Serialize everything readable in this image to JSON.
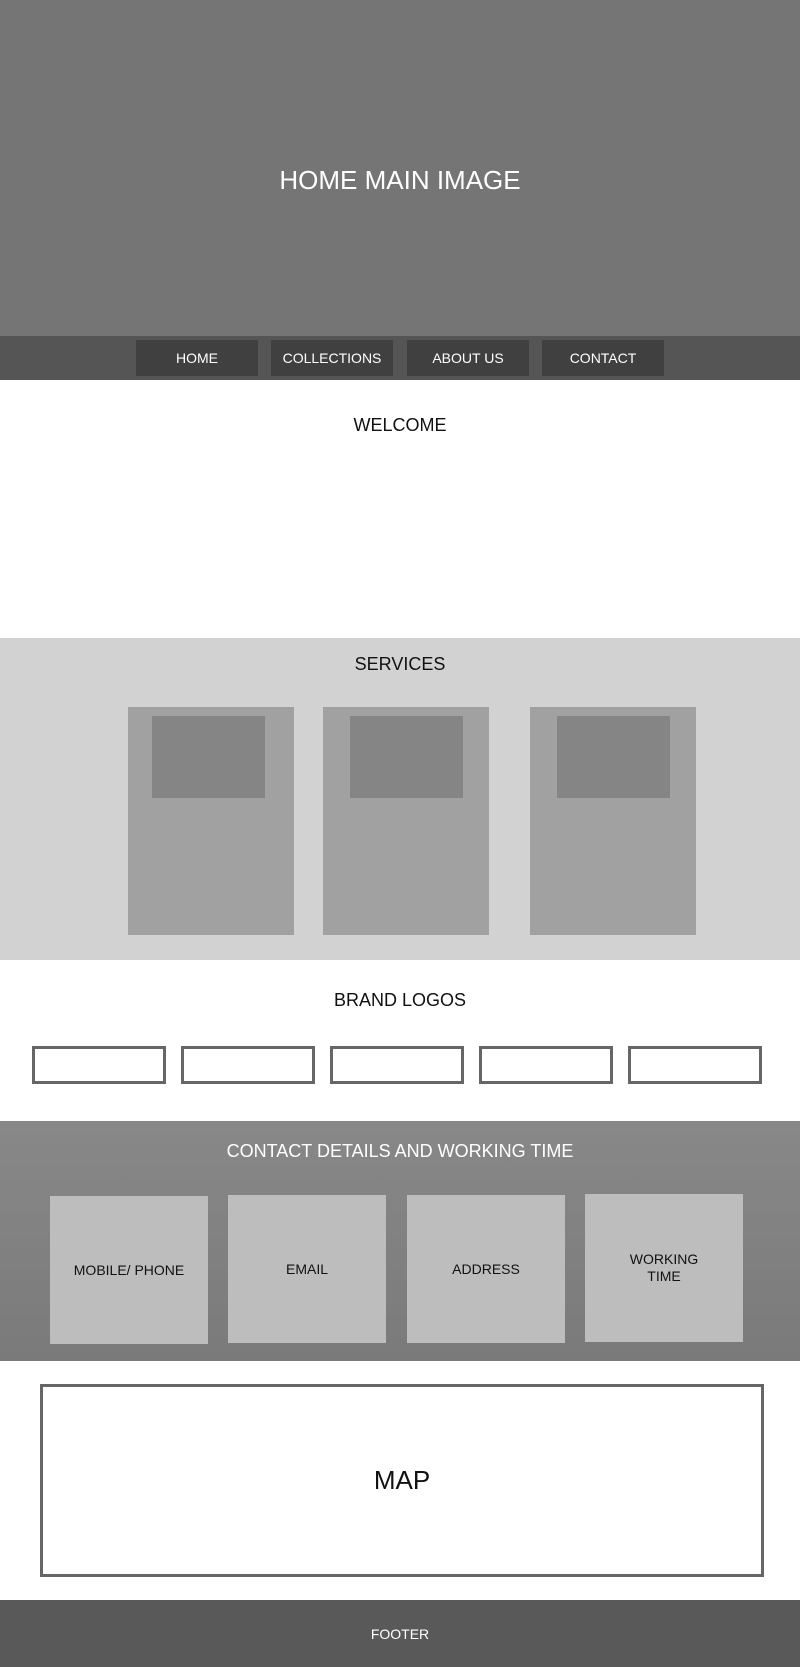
{
  "hero": {
    "title": "HOME MAIN IMAGE"
  },
  "nav": {
    "items": [
      {
        "label": "HOME"
      },
      {
        "label": "COLLECTIONS"
      },
      {
        "label": "ABOUT US"
      },
      {
        "label": "CONTACT"
      }
    ]
  },
  "welcome": {
    "title": "WELCOME"
  },
  "services": {
    "title": "SERVICES",
    "card_count": 3
  },
  "brands": {
    "title": "BRAND LOGOS",
    "logo_count": 5
  },
  "contact": {
    "title": "CONTACT DETAILS AND WORKING TIME",
    "cards": [
      {
        "label": "MOBILE/ PHONE"
      },
      {
        "label": "EMAIL"
      },
      {
        "label": "ADDRESS"
      },
      {
        "label": "WORKING TIME"
      }
    ]
  },
  "map": {
    "label": "MAP"
  },
  "footer": {
    "label": "FOOTER"
  },
  "colors": {
    "hero_bg": "#757575",
    "nav_bg": "#555555",
    "nav_item_bg": "#404040",
    "services_bg": "#d2d2d2",
    "card_bg": "#a1a1a1",
    "contact_bg": "#808080",
    "contact_card_bg": "#bdbdbd",
    "footer_bg": "#595959"
  }
}
